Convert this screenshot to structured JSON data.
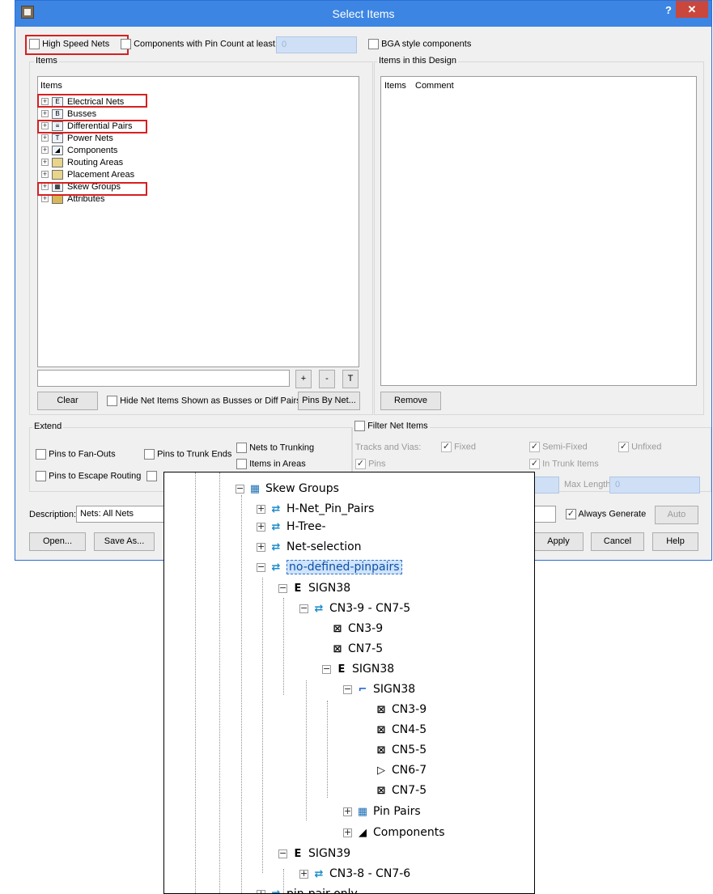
{
  "window": {
    "title": "Select Items",
    "help": "?",
    "close": "✕"
  },
  "top_options": {
    "high_speed_nets": "High Speed Nets",
    "pin_count": "Components with Pin Count at least:",
    "pin_count_value": "0",
    "bga": "BGA style components"
  },
  "items_panel": {
    "group_title": "Items",
    "list_header": "Items",
    "tree": [
      "Electrical Nets",
      "Busses",
      "Differential Pairs",
      "Power Nets",
      "Components",
      "Routing Areas",
      "Placement Areas",
      "Skew Groups",
      "Attributes"
    ],
    "plus": "+",
    "minus": "-",
    "t": "T",
    "clear": "Clear",
    "hide_net_items": "Hide Net Items Shown as Busses or Diff Pairs",
    "pins_by_net": "Pins By Net..."
  },
  "design_panel": {
    "group_title": "Items in this Design",
    "col_items": "Items",
    "col_comment": "Comment",
    "remove": "Remove"
  },
  "extend": {
    "title": "Extend",
    "pins_fanouts": "Pins to Fan-Outs",
    "pins_trunk_ends": "Pins to Trunk Ends",
    "nets_trunking": "Nets to Trunking",
    "items_in_areas": "Items in Areas",
    "pins_escape": "Pins to Escape Routing"
  },
  "filter": {
    "title": "Filter Net Items",
    "tracks_vias": "Tracks and Vias:",
    "fixed": "Fixed",
    "semi_fixed": "Semi-Fixed",
    "unfixed": "Unfixed",
    "pins": "Pins",
    "in_trunk_items": "In Trunk Items",
    "max_length": "Max Length:",
    "max_length_value": "0"
  },
  "bottom": {
    "description_label": "Description:",
    "description_value": "Nets: All Nets",
    "always_generate": "Always Generate",
    "auto": "Auto",
    "open": "Open...",
    "save_as": "Save As...",
    "apply": "Apply",
    "cancel": "Cancel",
    "help": "Help"
  },
  "zoom_tree": {
    "skew_groups": "Skew Groups",
    "h_net_pin_pairs": "H-Net_Pin_Pairs",
    "h_tree": "H-Tree-",
    "net_selection": "Net-selection",
    "no_defined": "no-defined-pinpairs",
    "sign38_a": "SIGN38",
    "cn3_9_cn7_5": "CN3-9 - CN7-5",
    "cn3_9_a": "CN3-9",
    "cn7_5_a": "CN7-5",
    "sign38_b": "SIGN38",
    "sign38_c": "SIGN38",
    "cn3_9_b": "CN3-9",
    "cn4_5": "CN4-5",
    "cn5_5": "CN5-5",
    "cn6_7": "CN6-7",
    "cn7_5_b": "CN7-5",
    "pin_pairs": "Pin Pairs",
    "components": "Components",
    "sign39": "SIGN39",
    "cn3_8_cn7_6": "CN3-8 - CN7-6",
    "pin_pair_only": "pin-pair-only"
  }
}
